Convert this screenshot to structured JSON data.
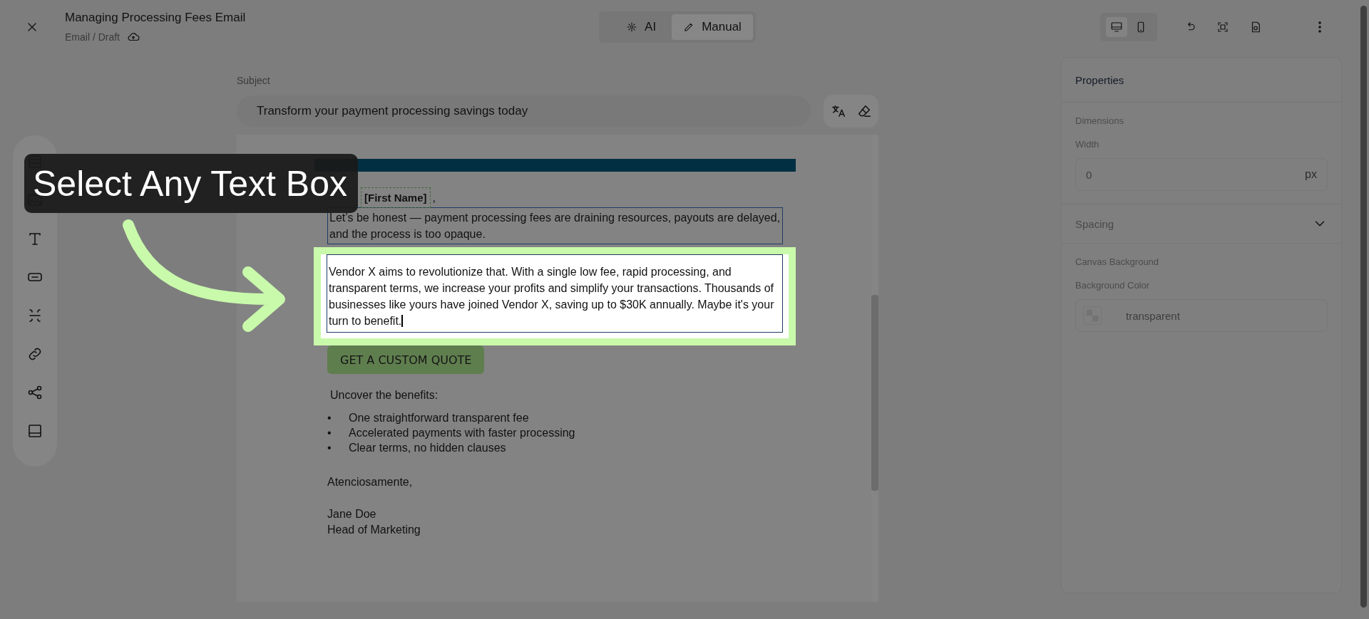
{
  "editor": {
    "title": "Managing Processing Fees Email",
    "breadcrumb": "Email / Draft"
  },
  "mode_switch": [
    {
      "label": "AI",
      "kind": "ai",
      "selected": false
    },
    {
      "label": "Manual",
      "kind": "manual",
      "selected": true
    }
  ],
  "device_toggle": [
    {
      "kind": "desktop",
      "selected": true
    },
    {
      "kind": "mobile",
      "selected": false
    }
  ],
  "subject": {
    "label": "Subject",
    "value": "Transform your payment processing savings today"
  },
  "email": {
    "greeting_name": "[First Name]",
    "greeting_suffix": ",",
    "paragraphs": [
      {
        "text": "Let’s be honest — payment processing fees are draining resources, payouts are delayed, and the process is too opaque.",
        "selected": false
      },
      {
        "text": "Vendor X aims to revolutionize that. With a single low fee, rapid processing, and transparent terms, we increase your profits and simplify your transactions. Thousands of businesses like yours have joined Vendor X, saving up to $30K annually. Maybe it's your turn to benefit.",
        "selected": true
      }
    ],
    "cta": "GET A CUSTOM QUOTE",
    "benefits_heading": "Uncover the benefits:",
    "benefits": [
      {
        "marker": "•",
        "text": "One straightforward transparent fee"
      },
      {
        "marker": "•",
        "text": "Accelerated payments with faster processing"
      },
      {
        "marker": "•",
        "text": "Clear terms, no hidden clauses"
      }
    ],
    "closing": "Atenciosamente,",
    "signature_name": "Jane Doe",
    "signature_title": "Head of Marketing"
  },
  "properties": {
    "title": "Properties",
    "dimensions": {
      "heading": "Dimensions",
      "width_label": "Width",
      "width_value": "0",
      "width_unit": "px"
    },
    "spacing": {
      "label": "Spacing",
      "expanded": false
    },
    "canvas_background": {
      "heading": "Canvas Background",
      "color_label": "Background Color",
      "color_value": "transparent"
    }
  },
  "tour": {
    "callout": "Select Any Text Box"
  }
}
